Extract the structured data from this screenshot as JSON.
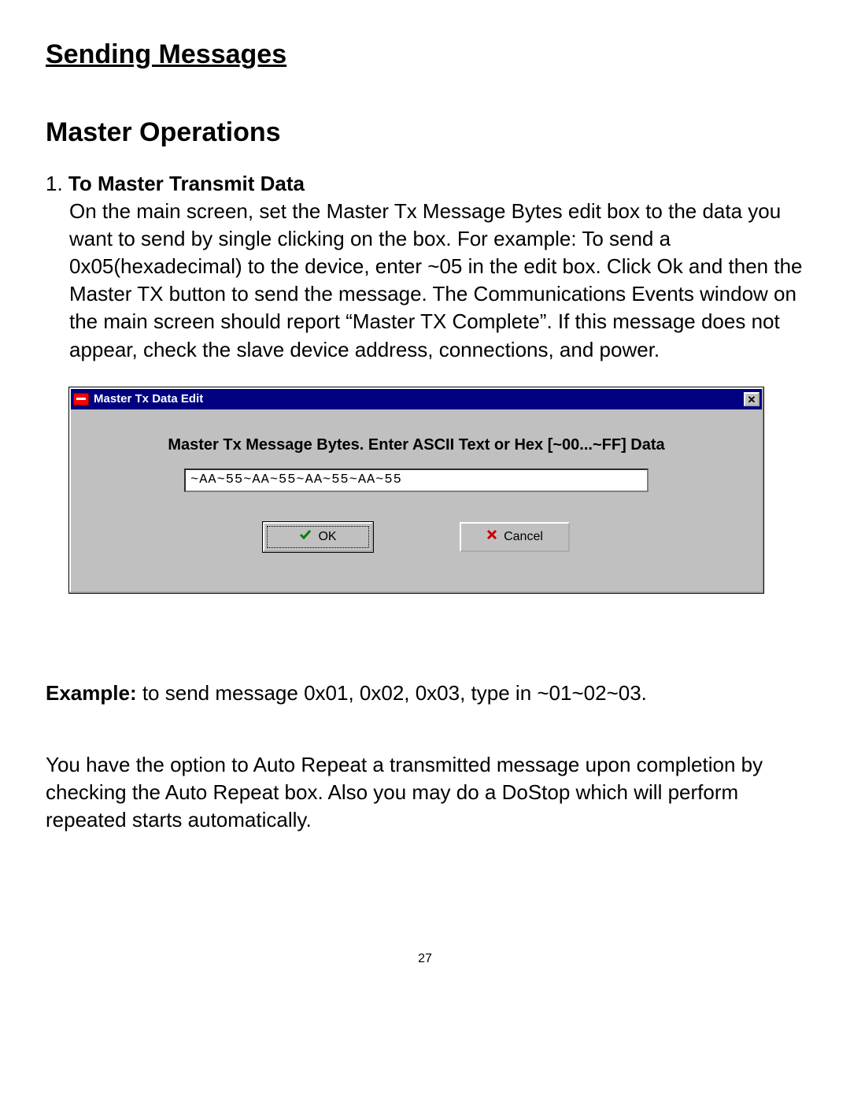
{
  "headings": {
    "h1": "Sending Messages",
    "h2": "Master Operations"
  },
  "item": {
    "number": "1. ",
    "title": "To Master Transmit Data",
    "body": "On the main screen, set the Master Tx Message Bytes edit box  to the data you want to send by single clicking on the box. For example: To send a 0x05(hexadecimal) to the device, enter ~05 in the edit box. Click Ok and then the Master TX button to send the message. The Communications Events window on the main screen should report “Master TX Complete”. If this message does not appear, check the slave device address, connections, and power."
  },
  "dialog": {
    "title": "Master Tx Data Edit",
    "close_glyph": "✕",
    "prompt": "Master Tx  Message Bytes. Enter ASCII Text or Hex [~00...~FF] Data",
    "input_value": "~AA~55~AA~55~AA~55~AA~55",
    "ok_label": "OK",
    "cancel_label": "Cancel"
  },
  "example": {
    "lead": "Example:",
    "text": " to send message 0x01, 0x02, 0x03, type in ~01~02~03."
  },
  "post_paragraph": "You have the option to Auto Repeat a transmitted message upon completion by checking the Auto Repeat box. Also you may do a DoStop which will perform repeated starts automatically.",
  "page_number": "27"
}
